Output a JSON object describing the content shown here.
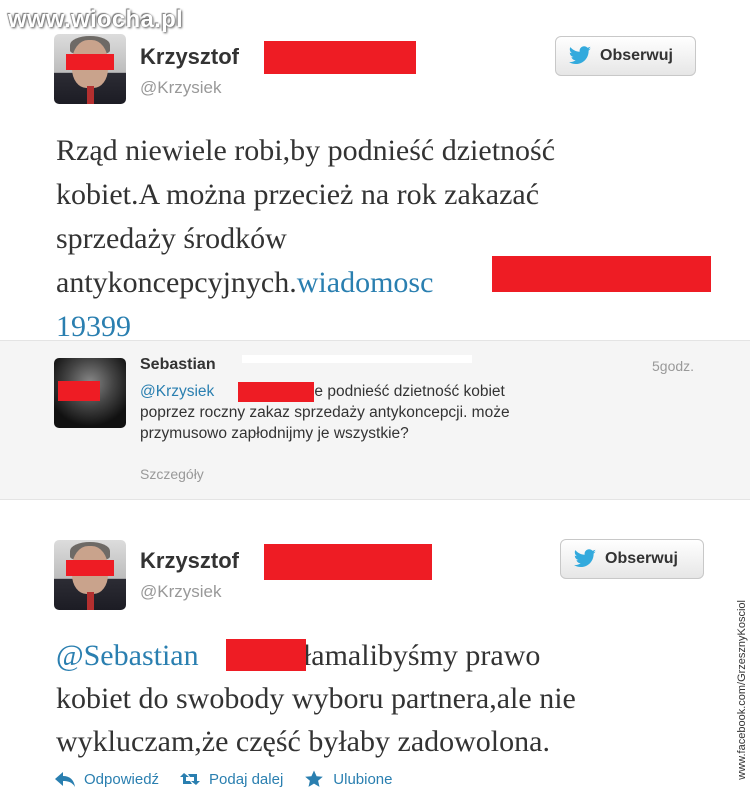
{
  "watermark": {
    "top": "www.wiocha.pl",
    "side": "www.facebook.com/GrzesznyKosciol"
  },
  "colors": {
    "link": "#2a7fb0",
    "redaction": "#ee1c24",
    "reply_background": "#f5f5f5"
  },
  "tweet1": {
    "author_name": "Krzysztof",
    "author_handle": "@Krzysiek",
    "follow_label": "Obserwuj",
    "text_lines": [
      "Rząd niewiele robi,by podnieść dzietność",
      "kobiet.A można przecież na rok zakazać",
      "sprzedaży środków"
    ],
    "text_line4": "antykoncepcyjnych.",
    "link_part1": "wiadomosc",
    "link_part2": "19399"
  },
  "reply": {
    "author_name": "Sebastian",
    "time": "5godz.",
    "handle": "@Krzysiek",
    "text_line1": "chce podnieść dzietność kobiet",
    "text_line2": "poprzez roczny zakaz sprzedaży antykoncepcji. może",
    "text_line3": "przymusowo zapłodnijmy je wszystkie?",
    "details_label": "Szczegóły"
  },
  "tweet2": {
    "author_name": "Krzysztof",
    "author_handle": "@Krzysiek",
    "follow_label": "Obserwuj",
    "mention": "@Sebastian",
    "text_line1_rest": "Złamalibyśmy prawo",
    "text_line2": "kobiet do swobody wyboru partnera,ale nie",
    "text_line3": "wykluczam,że część byłaby zadowolona."
  },
  "actions": {
    "reply_label": "Odpowiedź",
    "retweet_label": "Podaj dalej",
    "favorite_label": "Ulubione"
  },
  "icons": {
    "follow": "twitter-bird-icon",
    "reply": "reply-arrow-icon",
    "retweet": "retweet-icon",
    "favorite": "star-icon"
  }
}
